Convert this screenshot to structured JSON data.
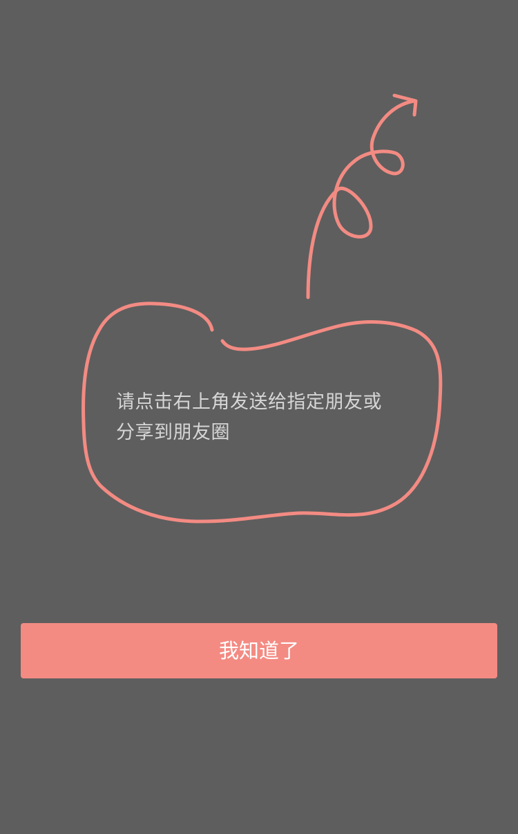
{
  "hint": {
    "line1": "请点击右上角发送给指定朋友或",
    "line2": "分享到朋友圈"
  },
  "confirm_button": {
    "label": "我知道了"
  },
  "icons": {
    "doodle": "curly-arrow-pointing-up-right-icon",
    "bubble": "hand-drawn-bubble-outline"
  },
  "colors": {
    "overlay": "#5e5e5e",
    "accent": "#f38b83",
    "hint_text": "#d6d6d6",
    "button_text": "#ffffff"
  }
}
